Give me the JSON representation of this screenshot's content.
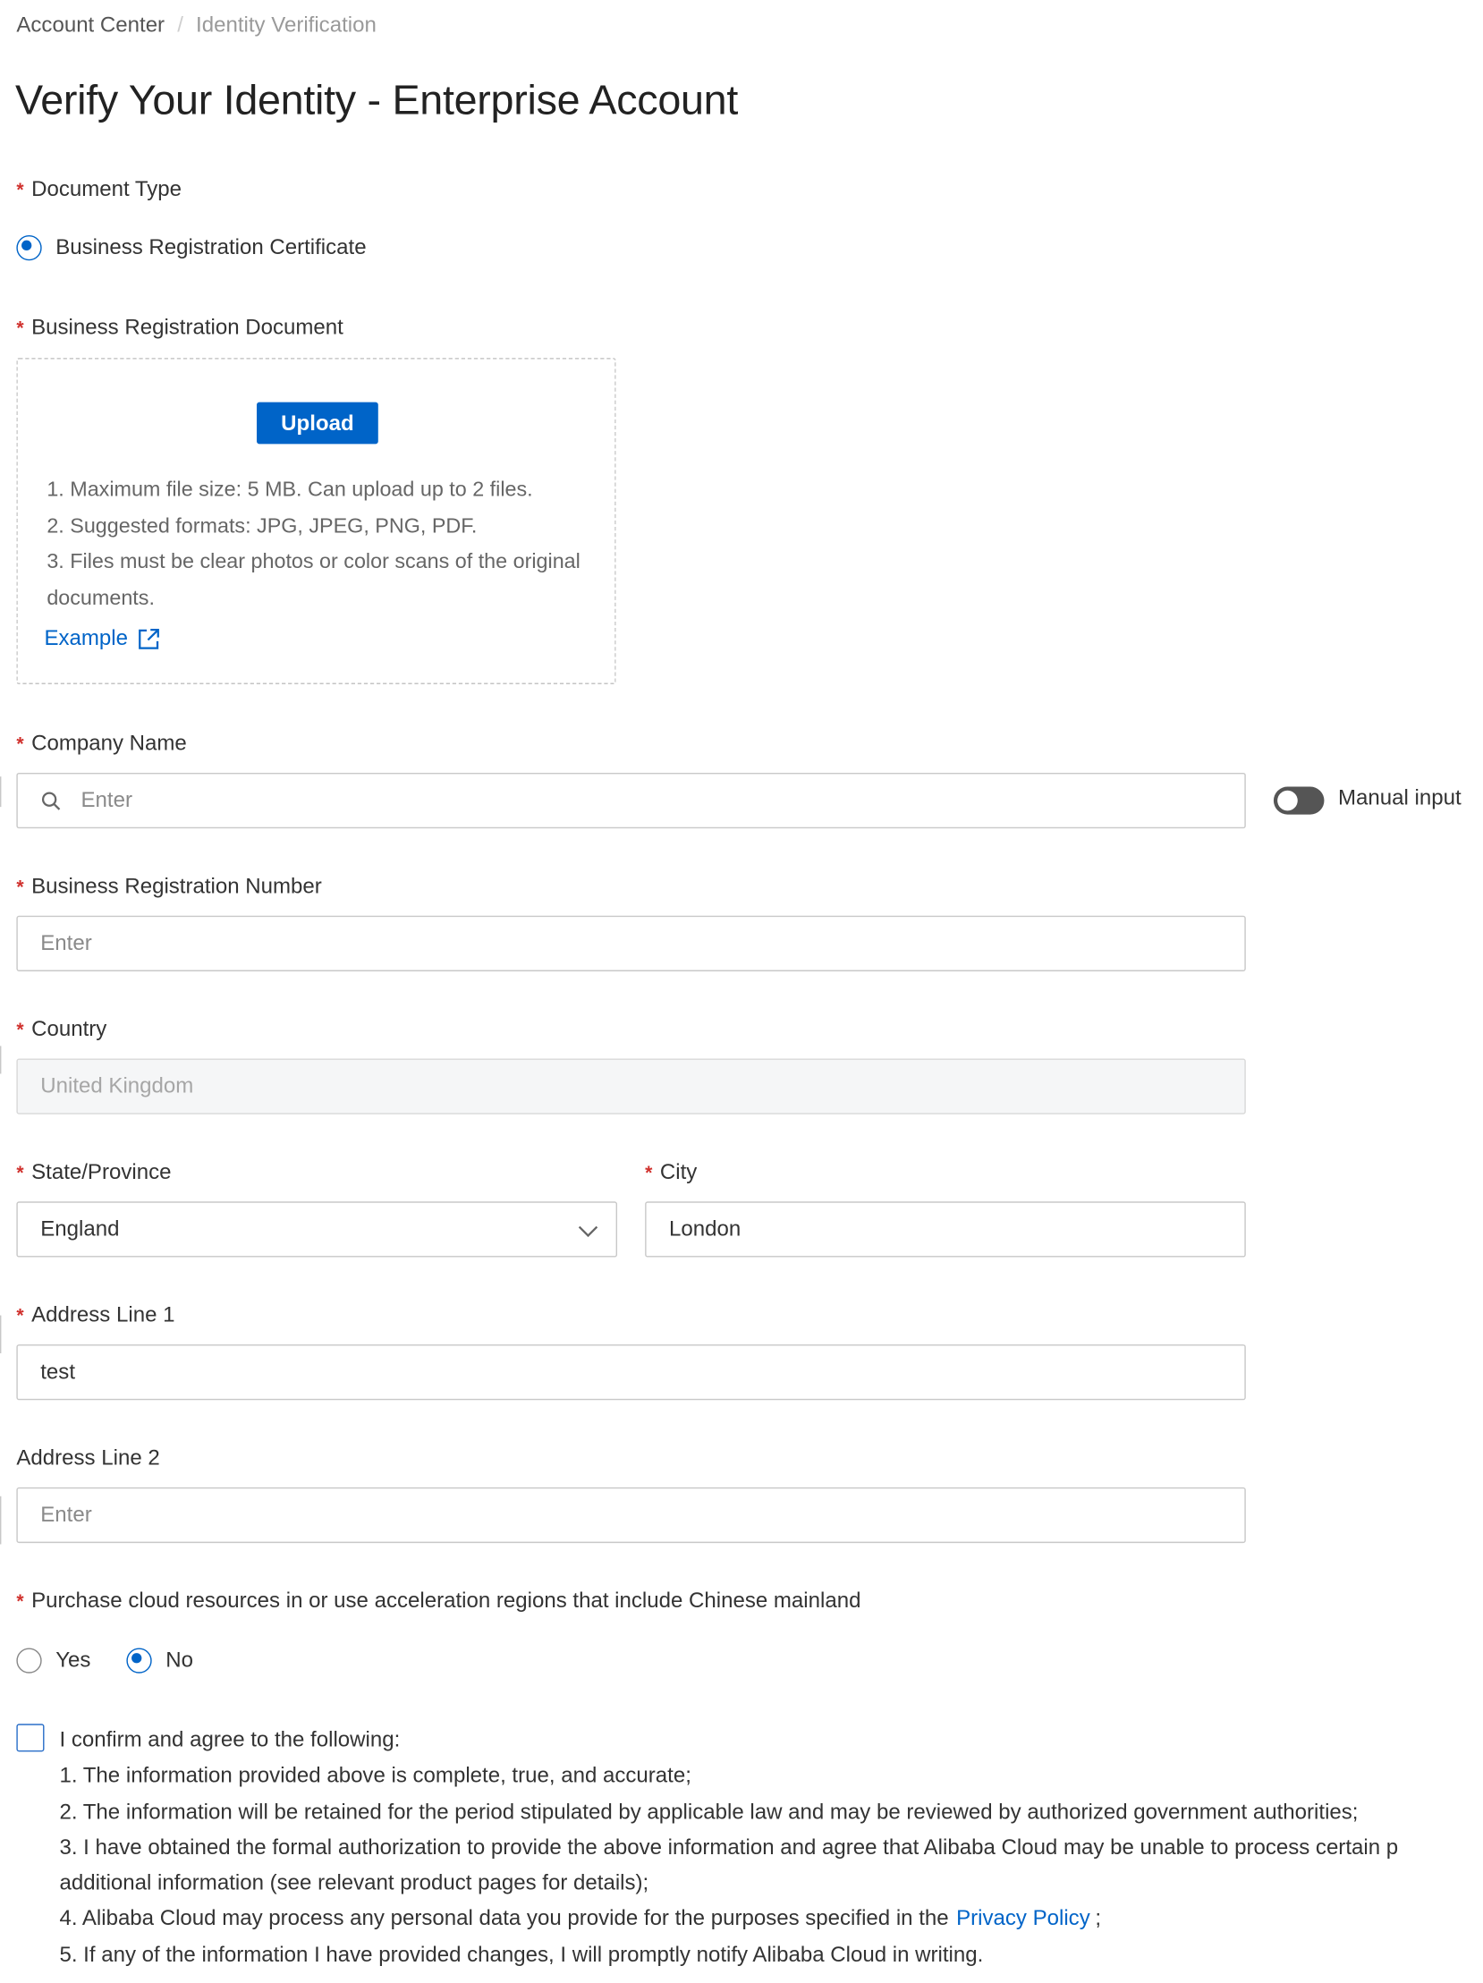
{
  "breadcrumb": {
    "home": "Account Center",
    "separator": "/",
    "current": "Identity Verification"
  },
  "page_title": "Verify Your Identity - Enterprise Account",
  "required_marker": "*",
  "document_type": {
    "label": "Document Type",
    "option": "Business Registration Certificate",
    "selected": true
  },
  "business_doc": {
    "label": "Business Registration Document",
    "upload_button": "Upload",
    "tips": [
      "1. Maximum file size: 5 MB. Can upload up to 2 files.",
      "2. Suggested formats: JPG, JPEG, PNG, PDF.",
      "3. Files must be clear photos or color scans of the original documents."
    ],
    "example_link": "Example",
    "example_icon": "external-link-icon"
  },
  "company_name": {
    "label": "Company Name",
    "placeholder": "Enter",
    "icon": "search-icon",
    "manual_input_label": "Manual input",
    "manual_input_on": false
  },
  "registration_number": {
    "label": "Business Registration Number",
    "placeholder": "Enter"
  },
  "country": {
    "label": "Country",
    "value": "United Kingdom",
    "disabled": true
  },
  "state": {
    "label": "State/Province",
    "value": "England",
    "icon": "chevron-down-icon"
  },
  "city": {
    "label": "City",
    "value": "London"
  },
  "address1": {
    "label": "Address Line 1",
    "value": "test"
  },
  "address2": {
    "label": "Address Line 2",
    "placeholder": "Enter"
  },
  "mainland": {
    "label": "Purchase cloud resources in or use acceleration regions that include Chinese mainland",
    "options": [
      "Yes",
      "No"
    ],
    "selected": "No"
  },
  "agreement": {
    "checked": false,
    "intro": "I confirm and agree to the following:",
    "item1": "1. The information provided above is complete, true, and accurate;",
    "item2": "2. The information will be retained for the period stipulated by applicable law and may be reviewed by authorized government authorities;",
    "item3a": "3. I have obtained the formal authorization to provide the above information and agree that Alibaba Cloud may be unable to process certain p",
    "item3b": "additional information (see relevant product pages for details);",
    "item4_prefix": "4. Alibaba Cloud may process any personal data you provide for the purposes specified in the",
    "item4_link": "Privacy Policy",
    "item4_suffix": ";",
    "item5": "5. If any of the information I have provided changes, I will promptly notify Alibaba Cloud in writing."
  },
  "colors": {
    "primary": "#0064c8",
    "required": "#d0312d",
    "text": "#333333",
    "placeholder": "#8a8a8a",
    "border": "#c8c8c8"
  }
}
